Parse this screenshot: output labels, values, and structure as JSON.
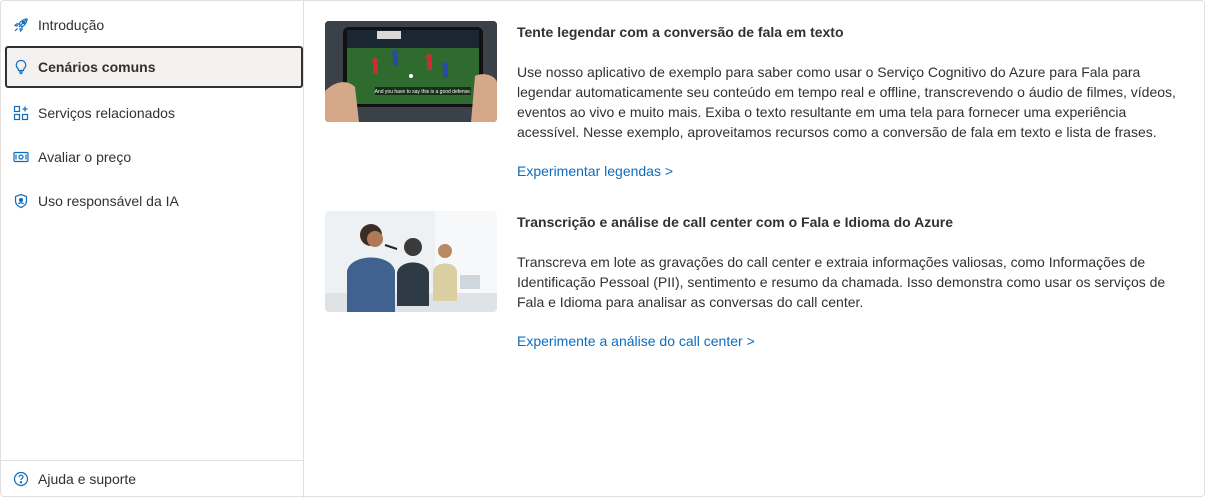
{
  "sidebar": {
    "items": [
      {
        "label": "Introdução",
        "icon": "rocket-icon",
        "active": false
      },
      {
        "label": "Cenários comuns",
        "icon": "lightbulb-icon",
        "active": true
      },
      {
        "label": "Serviços relacionados",
        "icon": "grid-add-icon",
        "active": false
      },
      {
        "label": "Avaliar o preço",
        "icon": "money-icon",
        "active": false
      },
      {
        "label": "Uso responsável da IA",
        "icon": "shield-icon",
        "active": false
      }
    ],
    "footer": {
      "label": "Ajuda e suporte",
      "icon": "help-circle-icon"
    }
  },
  "cards": [
    {
      "title": "Tente legendar com a conversão de fala em texto",
      "description": "Use nosso aplicativo de exemplo para saber como usar o Serviço Cognitivo do Azure para Fala para legendar automaticamente seu conteúdo em tempo real e offline, transcrevendo o áudio de filmes, vídeos, eventos ao vivo e muito mais. Exiba o texto resultante em uma tela para fornecer uma experiência acessível. Nesse exemplo, aproveitamos recursos como a conversão de fala em texto e lista de frases.",
      "link": "Experimentar legendas >",
      "image": "soccer-phone-captions-image",
      "image_caption": "And you have to say this is a good defense."
    },
    {
      "title": "Transcrição e análise de call center com o Fala e Idioma do Azure",
      "description": "Transcreva em lote as gravações do call center e extraia informações valiosas, como Informações de Identificação Pessoal (PII), sentimento e resumo da chamada. Isso demonstra como usar os serviços de Fala e Idioma para analisar as conversas do call center.",
      "link": "Experimente a análise do call center >",
      "image": "call-center-agents-image"
    }
  ],
  "colors": {
    "link": "#0f6cbd",
    "text": "#323130",
    "border": "#e1dfdd",
    "active_bg": "#f3f2f1"
  }
}
